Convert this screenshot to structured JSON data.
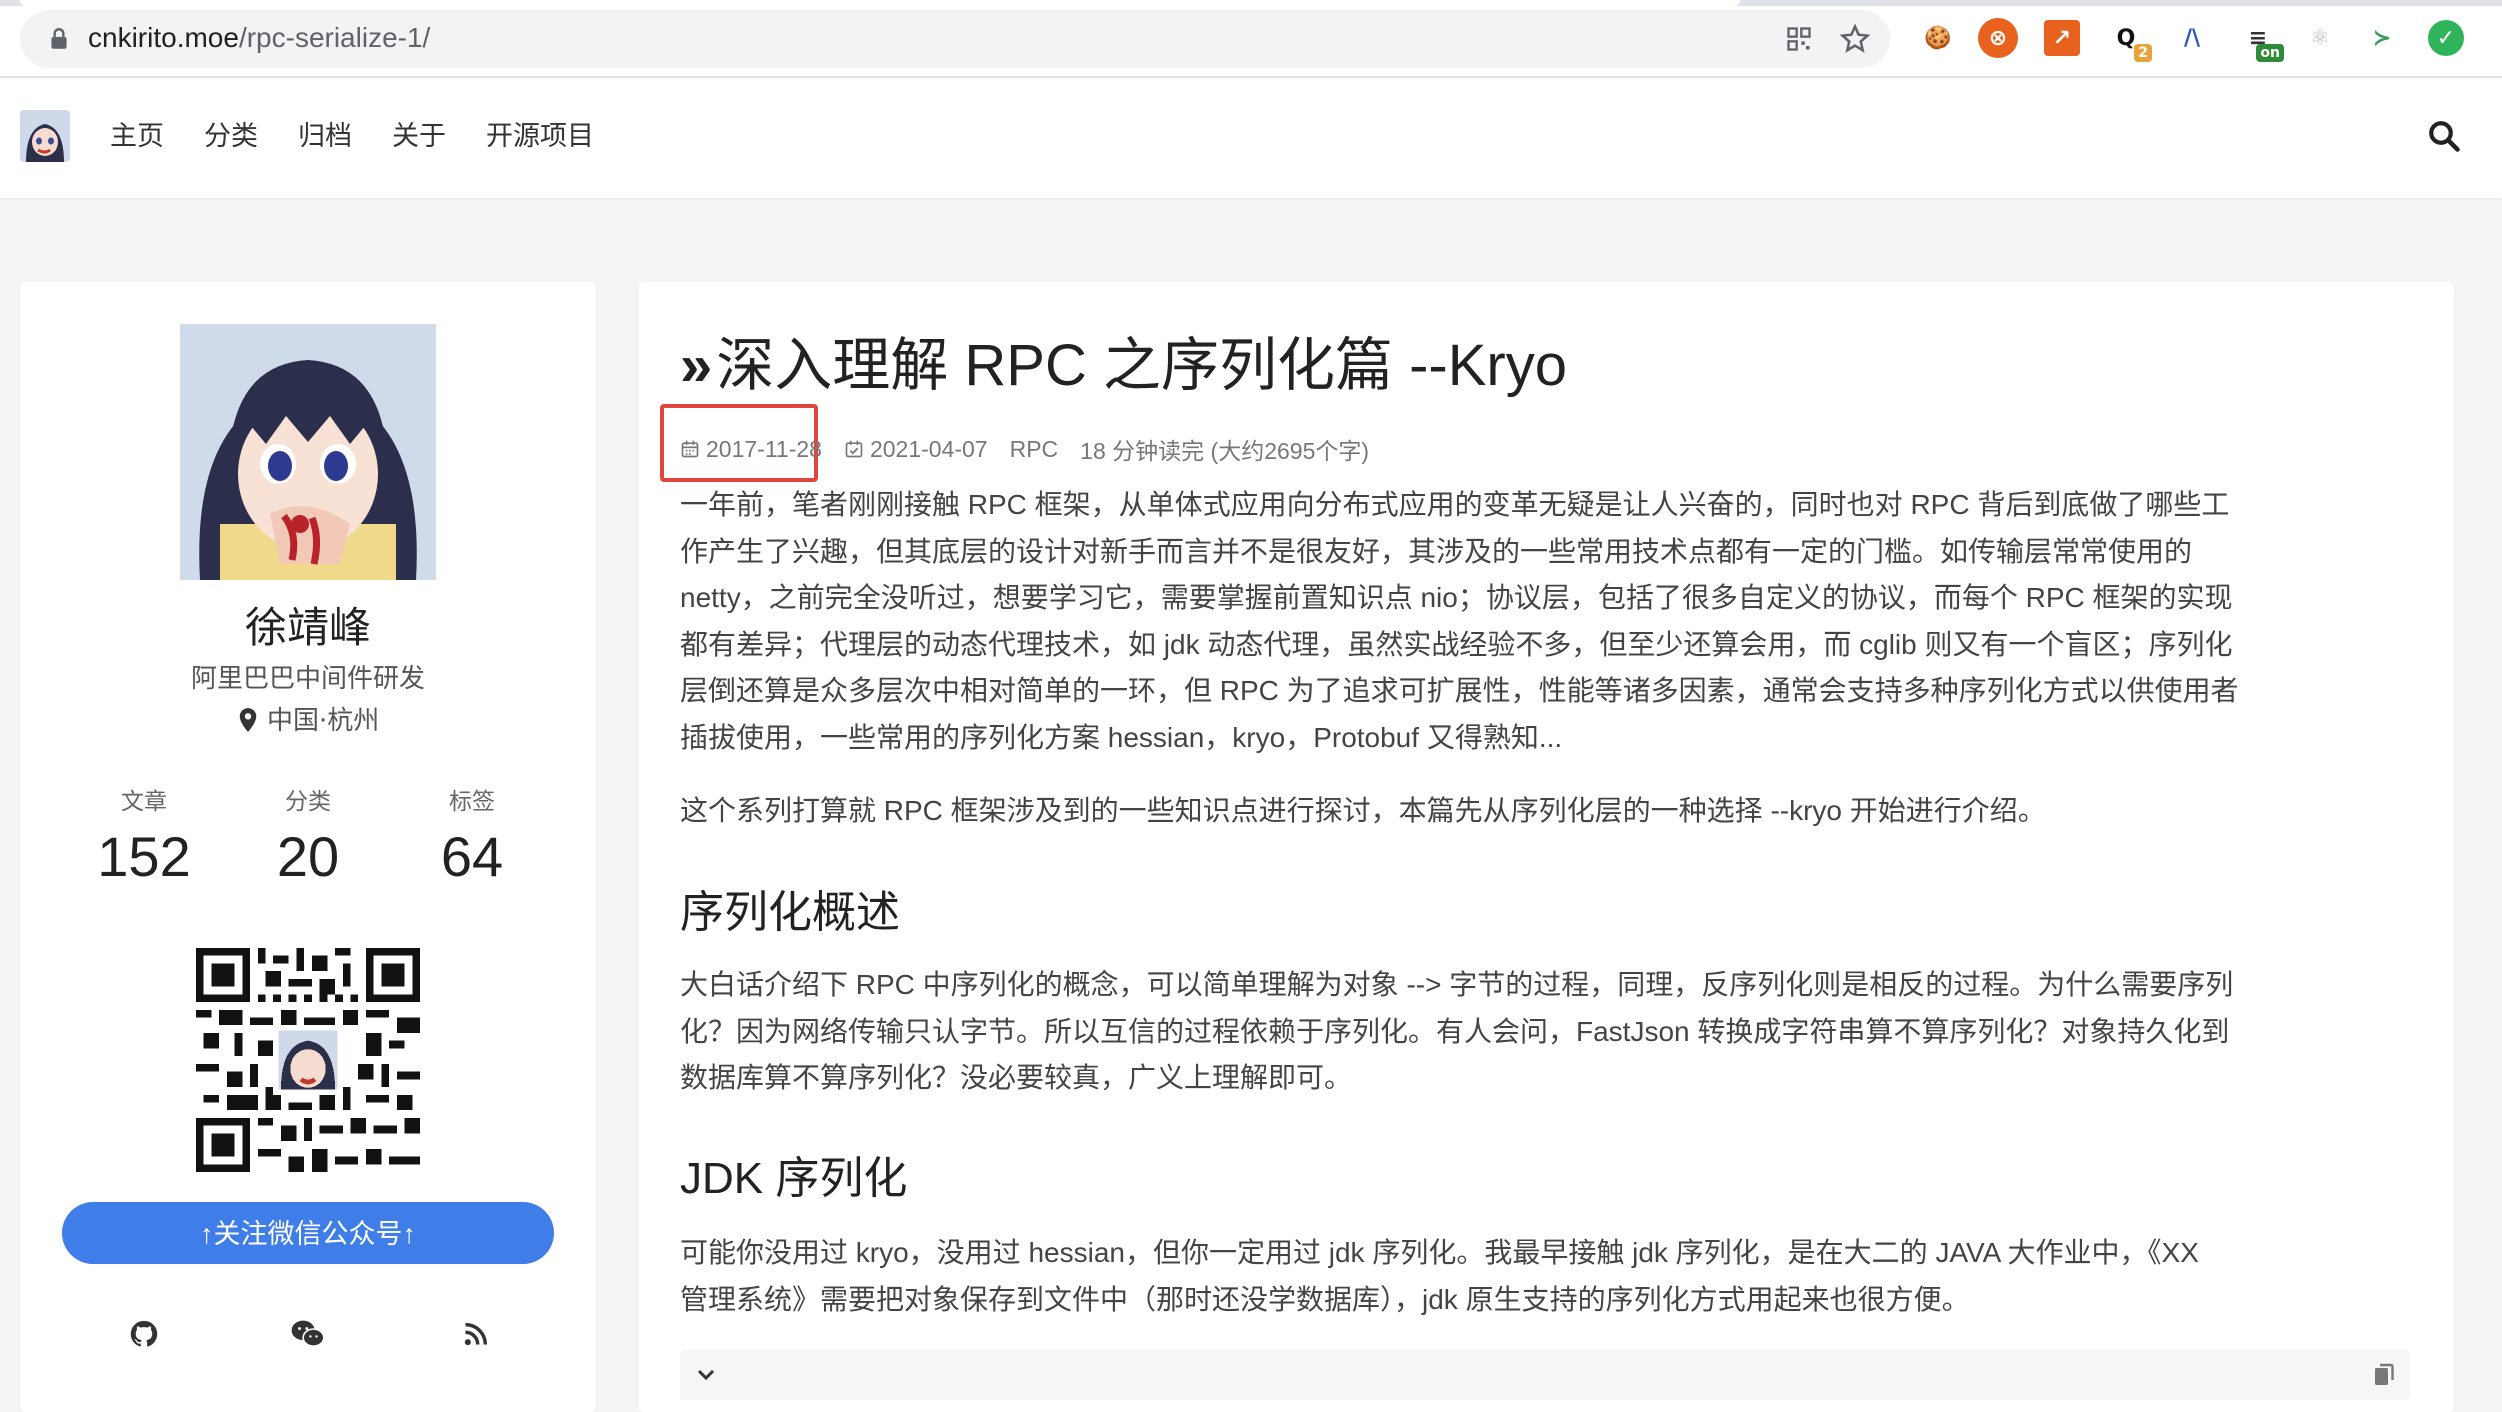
{
  "browser": {
    "url_host": "cnkirito.moe",
    "url_path": "/rpc-serialize-1/",
    "extensions": [
      {
        "name": "cookie",
        "label": "🍪",
        "color": "#c98a3a"
      },
      {
        "name": "rsshub",
        "label": "⊗",
        "color": "#e8621d"
      },
      {
        "name": "analytics",
        "label": "↗",
        "color": "#e8621d"
      },
      {
        "name": "octotree",
        "label": "Q",
        "color": "#111111",
        "badge": "2"
      },
      {
        "name": "altair",
        "label": "/\\",
        "color": "#2a55c5"
      },
      {
        "name": "list-on",
        "label": "≡",
        "color": "#333333",
        "badge": "on"
      },
      {
        "name": "react-devtools",
        "label": "⚛",
        "color": "#bbbbbb"
      },
      {
        "name": "bird",
        "label": "≻",
        "color": "#3a9a5a"
      },
      {
        "name": "vue-devtools",
        "label": "✓",
        "color": "#2fb45a"
      }
    ]
  },
  "nav": {
    "items": [
      "主页",
      "分类",
      "归档",
      "关于",
      "开源项目"
    ]
  },
  "sidebar": {
    "name": "徐靖峰",
    "description": "阿里巴巴中间件研发",
    "location": "中国·杭州",
    "stats": [
      {
        "label": "文章",
        "value": "152"
      },
      {
        "label": "分类",
        "value": "20"
      },
      {
        "label": "标签",
        "value": "64"
      }
    ],
    "follow_label": "↑关注微信公众号↑"
  },
  "post": {
    "title_prefix": "»",
    "title": "深入理解 RPC 之序列化篇 --Kryo",
    "created": "2017-11-28",
    "updated": "2021-04-07",
    "category": "RPC",
    "reading": "18 分钟读完 (大约2695个字)",
    "intro_lines": [
      "一年前，笔者刚刚接触 RPC 框架，从单体式应用向分布式应用的变革无疑是让人兴奋的，同时也对 RPC 背后到底做了哪些工",
      "作产生了兴趣，但其底层的设计对新手而言并不是很友好，其涉及的一些常用技术点都有一定的门槛。如传输层常常使用的",
      "netty，之前完全没听过，想要学习它，需要掌握前置知识点 nio；协议层，包括了很多自定义的协议，而每个 RPC 框架的实现",
      "都有差异；代理层的动态代理技术，如 jdk 动态代理，虽然实战经验不多，但至少还算会用，而 cglib 则又有一个盲区；序列化",
      "层倒还算是众多层次中相对简单的一环，但 RPC 为了追求可扩展性，性能等诸多因素，通常会支持多种序列化方式以供使用者",
      "插拔使用，一些常用的序列化方案 hessian，kryo，Protobuf 又得熟知..."
    ],
    "series_note": "这个系列打算就 RPC 框架涉及到的一些知识点进行探讨，本篇先从序列化层的一种选择 --kryo 开始进行介绍。",
    "section1_title": "序列化概述",
    "section1_lines": [
      "大白话介绍下 RPC 中序列化的概念，可以简单理解为对象 --> 字节的过程，同理，反序列化则是相反的过程。为什么需要序列",
      "化？因为网络传输只认字节。所以互信的过程依赖于序列化。有人会问，FastJson 转换成字符串算不算序列化？对象持久化到",
      "数据库算不算序列化？没必要较真，广义上理解即可。"
    ],
    "section2_title": "JDK 序列化",
    "section2_lines": [
      "可能你没用过 kryo，没用过 hessian，但你一定用过 jdk 序列化。我最早接触 jdk 序列化，是在大二的 JAVA 大作业中，《XX",
      "管理系统》需要把对象保存到文件中（那时还没学数据库），jdk 原生支持的序列化方式用起来也很方便。"
    ]
  }
}
